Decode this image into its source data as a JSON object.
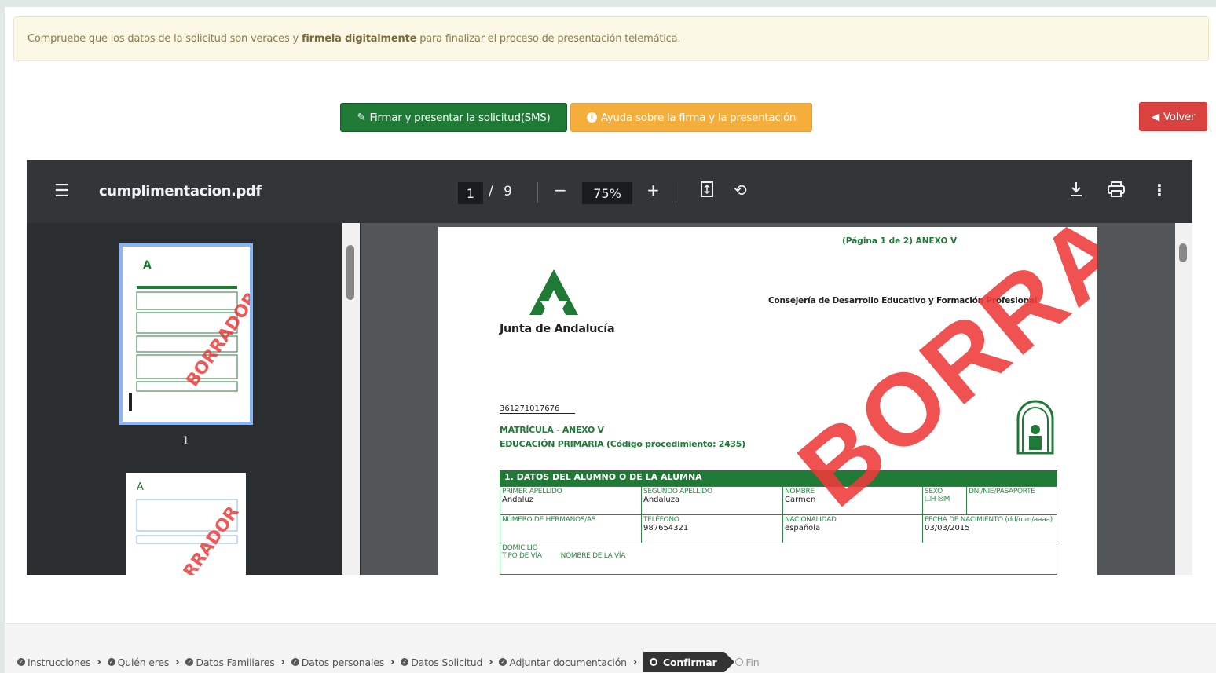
{
  "alert": {
    "text_before": "Compruebe que los datos de la solicitud son veraces y",
    "text_bold": "firmela digitalmente",
    "text_after": "para finalizar el proceso de presentación telemática."
  },
  "actions": {
    "sign_label": "Firmar y presentar la solicitud(SMS)",
    "help_label": "Ayuda sobre la firma y la presentación",
    "back_label": "Volver"
  },
  "viewer": {
    "filename": "cumplimentacion.pdf",
    "current_page": "1",
    "page_separator": "/",
    "total_pages": "9",
    "zoom": "75%",
    "thumb1_label": "1"
  },
  "document": {
    "page_info": "(Página 1 de 2)  ANEXO V",
    "org_name": "Junta de Andalucía",
    "department": "Consejería de Desarrollo Educativo y Formación Profesional",
    "code": "361271017676",
    "title_line1": "MATRÍCULA  -  ANEXO V",
    "title_line2": "EDUCACIÓN PRIMARIA (Código procedimiento: 2435)",
    "section1_title": "1. DATOS DEL ALUMNO O DE LA ALUMNA",
    "watermark": "BORRADOR",
    "fields": {
      "primer_apellido_label": "PRIMER APELLIDO",
      "primer_apellido": "Andaluz",
      "segundo_apellido_label": "SEGUNDO APELLIDO",
      "segundo_apellido": "Andaluza",
      "nombre_label": "NOMBRE",
      "nombre": "Carmen",
      "sexo_label": "SEXO",
      "sexo_h": "H",
      "sexo_m": "M",
      "dni_label": "DNI/NIE/PASAPORTE",
      "hermanos_label": "NÚMERO DE HERMANOS/AS",
      "telefono_label": "TELÉFONO",
      "telefono": "987654321",
      "nacionalidad_label": "NACIONALIDAD",
      "nacionalidad": "española",
      "fecha_label": "FECHA DE NACIMIENTO (dd/mm/aaaa)",
      "fecha": "03/03/2015",
      "domicilio_label": "DOMICILIO",
      "tipo_via_label": "TIPO DE VÍA",
      "nombre_via_label": "NOMBRE DE LA VÍA"
    }
  },
  "steps": [
    {
      "label": "Instrucciones"
    },
    {
      "label": "Quién eres"
    },
    {
      "label": "Datos Familiares"
    },
    {
      "label": "Datos personales"
    },
    {
      "label": "Datos Solicitud"
    },
    {
      "label": "Adjuntar documentación"
    },
    {
      "label": "Confirmar"
    },
    {
      "label": "Fin"
    }
  ],
  "colors": {
    "green": "#1f7a35",
    "orange": "#f5ad3b",
    "red": "#d9423f",
    "watermark": "#ee3a3a"
  }
}
